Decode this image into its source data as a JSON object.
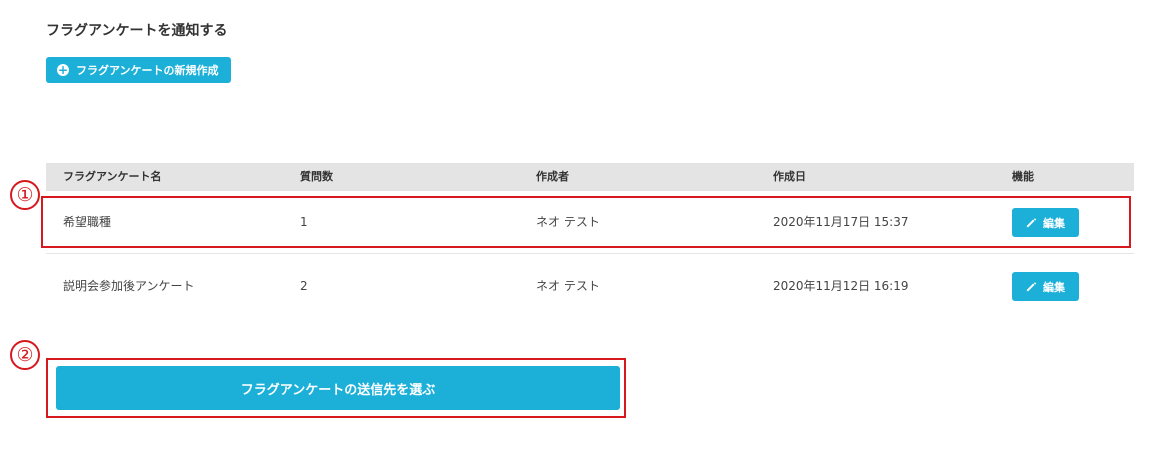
{
  "page": {
    "title": "フラグアンケートを通知する"
  },
  "toolbar": {
    "new_survey_label": "フラグアンケートの新規作成",
    "new_survey_icon": "plus-circle-icon"
  },
  "table": {
    "headers": [
      "フラグアンケート名",
      "質問数",
      "作成者",
      "作成日",
      "機能"
    ],
    "rows": [
      {
        "name": "希望職種",
        "question_count": "1",
        "author": "ネオ テスト",
        "created_at": "2020年11月17日 15:37",
        "action_label": "編集"
      },
      {
        "name": "説明会参加後アンケート",
        "question_count": "2",
        "author": "ネオ テスト",
        "created_at": "2020年11月12日 16:19",
        "action_label": "編集"
      }
    ]
  },
  "annotations": {
    "marker_1": "①",
    "marker_2": "②",
    "highlight_color": "#d6191e"
  },
  "footer": {
    "select_recipients_label": "フラグアンケートの送信先を選ぶ"
  },
  "colors": {
    "accent": "#1cb0d9",
    "header_bg": "#e4e4e4"
  }
}
